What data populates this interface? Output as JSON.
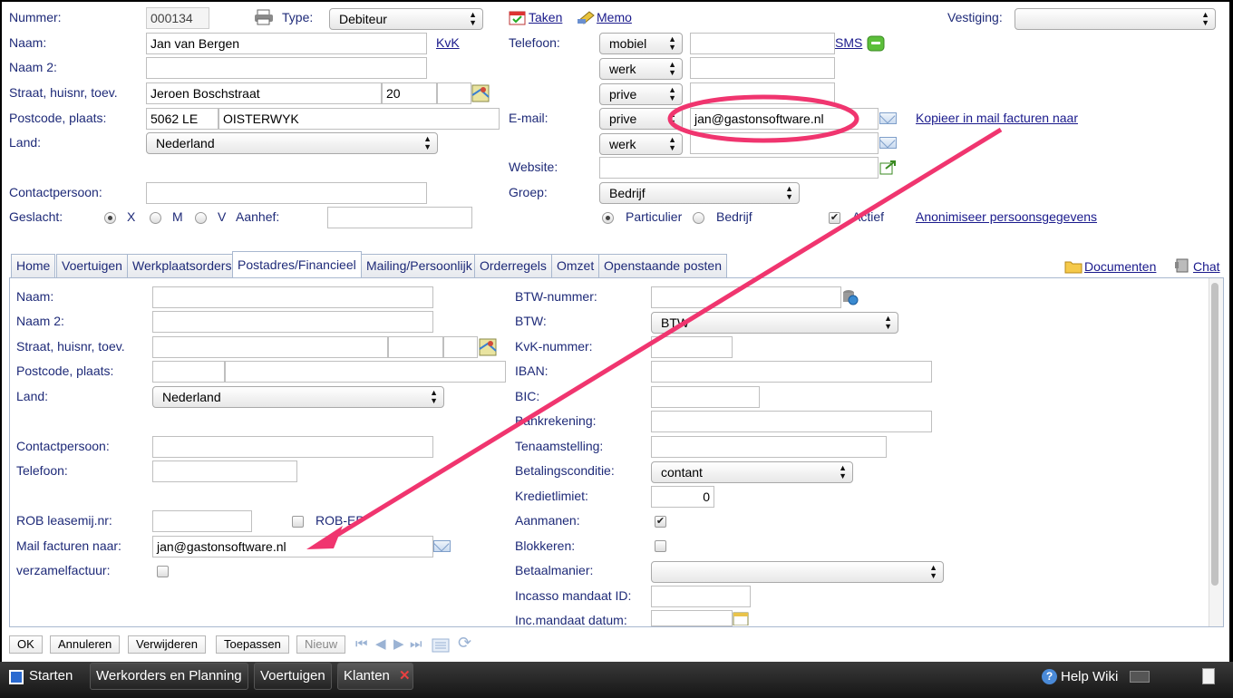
{
  "top": {
    "nummer_label": "Nummer:",
    "nummer_value": "000134",
    "type_label": "Type:",
    "type_value": "Debiteur",
    "taken": "Taken",
    "memo": "Memo",
    "vestiging_label": "Vestiging:",
    "vestiging_value": "",
    "naam_label": "Naam:",
    "naam_value": "Jan van Bergen",
    "kvk": "KvK",
    "telefoon_label": "Telefoon:",
    "phone_types": [
      "mobiel",
      "werk",
      "prive"
    ],
    "sms": "SMS",
    "naam2_label": "Naam 2:",
    "straat_label": "Straat, huisnr, toev.",
    "straat_value": "Jeroen Boschstraat",
    "huisnr_value": "20",
    "postcode_label": "Postcode, plaats:",
    "postcode_value": "5062 LE",
    "plaats_value": "OISTERWYK",
    "email_label": "E-mail:",
    "email_type1": "prive",
    "email_value1": "jan@gastonsoftware.nl",
    "email_type2": "werk",
    "kopieer": "Kopieer in mail facturen naar",
    "land_label": "Land:",
    "land_value": "Nederland",
    "website_label": "Website:",
    "contact_label": "Contactpersoon:",
    "groep_label": "Groep:",
    "groep_value": "Bedrijf",
    "geslacht_label": "Geslacht:",
    "gender_x": "X",
    "gender_m": "M",
    "gender_v": "V",
    "aanhef_label": "Aanhef:",
    "particulier": "Particulier",
    "bedrijf": "Bedrijf",
    "actief": "Actief",
    "anonimiseer": "Anonimiseer persoonsgegevens"
  },
  "tabs": [
    "Home",
    "Voertuigen",
    "Werkplaatsorders",
    "Postadres/Financieel",
    "Mailing/Persoonlijk",
    "Orderregels",
    "Omzet",
    "Openstaande posten"
  ],
  "active_tab": "Postadres/Financieel",
  "documenten": "Documenten",
  "chat": "Chat",
  "left": {
    "naam": "Naam:",
    "naam2": "Naam 2:",
    "straat": "Straat, huisnr, toev.",
    "postcode": "Postcode, plaats:",
    "land": "Land:",
    "land_value": "Nederland",
    "contact": "Contactpersoon:",
    "telefoon": "Telefoon:",
    "rob": "ROB leasemij.nr:",
    "rob_ep": "ROB-EP",
    "mail_facturen": "Mail facturen naar:",
    "mail_facturen_value": "jan@gastonsoftware.nl",
    "verzamel": "verzamelfactuur:"
  },
  "right": {
    "btw_nummer": "BTW-nummer:",
    "btw": "BTW:",
    "btw_value": "BTW",
    "kvk_nummer": "KvK-nummer:",
    "iban": "IBAN:",
    "bic": "BIC:",
    "bankrekening": "Bankrekening:",
    "tenaamstelling": "Tenaamstelling:",
    "betalingsconditie": "Betalingsconditie:",
    "betalingsconditie_value": "contant",
    "kredietlimiet": "Kredietlimiet:",
    "kredietlimiet_value": "0",
    "aanmanen": "Aanmanen:",
    "blokkeren": "Blokkeren:",
    "betaalmanier": "Betaalmanier:",
    "incasso_id": "Incasso mandaat ID:",
    "inc_datum": "Inc.mandaat datum:"
  },
  "buttons": {
    "ok": "OK",
    "annuleren": "Annuleren",
    "verwijderen": "Verwijderen",
    "toepassen": "Toepassen",
    "nieuw": "Nieuw"
  },
  "taskbar": {
    "starten": "Starten",
    "werkorders": "Werkorders en Planning",
    "voertuigen": "Voertuigen",
    "klanten": "Klanten",
    "help": "Help Wiki"
  },
  "colors": {
    "annotation": "#f0356f",
    "link": "#1a1a8c",
    "label": "#1e2a78"
  }
}
